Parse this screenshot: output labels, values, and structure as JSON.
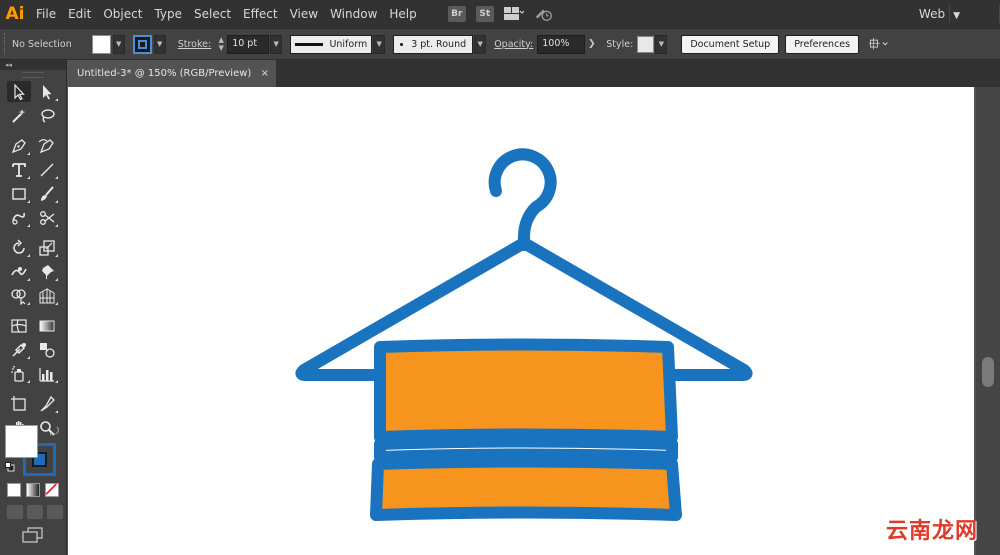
{
  "app": {
    "logo": "Ai"
  },
  "menubar": {
    "items": [
      "File",
      "Edit",
      "Object",
      "Type",
      "Select",
      "Effect",
      "View",
      "Window",
      "Help"
    ],
    "bridge_label": "Br",
    "stock_label": "St",
    "workspace": "Web"
  },
  "control": {
    "selection": "No Selection",
    "stroke_label": "Stroke:",
    "stroke_weight": "10 pt",
    "profile": "Uniform",
    "brush": "3 pt. Round",
    "opacity_label": "Opacity:",
    "opacity": "100%",
    "style_label": "Style:",
    "document_setup": "Document Setup",
    "preferences": "Preferences"
  },
  "document": {
    "tab_title": "Untitled-3* @ 150% (RGB/Preview)",
    "close_glyph": "×"
  },
  "colors": {
    "hanger_blue": "#1a73bf",
    "towel_orange": "#f7941e",
    "artboard": "#ffffff",
    "stroke_color": "#1e6bb8",
    "fill_color": "#ffffff"
  },
  "watermark": "云南龙网"
}
